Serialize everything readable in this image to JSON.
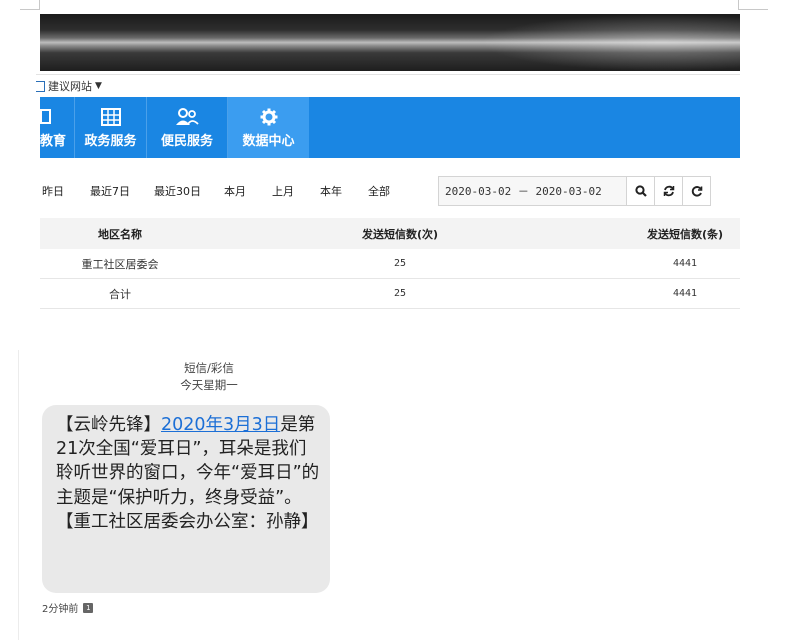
{
  "link_bar": {
    "label": "建议网站"
  },
  "nav": {
    "items": [
      {
        "label": "教育"
      },
      {
        "label": "政务服务"
      },
      {
        "label": "便民服务"
      },
      {
        "label": "数据中心"
      }
    ],
    "active_color": "#3b9df0",
    "bar_color": "#1a86e3"
  },
  "filters": {
    "tabs": [
      "昨日",
      "最近7日",
      "最近30日",
      "本月",
      "上月",
      "本年",
      "全部"
    ],
    "date_range": "2020-03-02 － 2020-03-02"
  },
  "table": {
    "headers": [
      "地区名称",
      "发送短信数(次)",
      "发送短信数(条)"
    ],
    "rows": [
      [
        "重工社区居委会",
        "25",
        "4441"
      ],
      [
        "合计",
        "25",
        "4441"
      ]
    ]
  },
  "message": {
    "channel": "短信/彩信",
    "day": "今天星期一",
    "body_start": "【云岭先锋】",
    "body_link": "2020年3月3日",
    "body_rest": "是第21次全国“爱耳日”，耳朵是我们聆听世界的窗口，今年“爱耳日”的主题是“保护听力，终身受益”。【重工社区居委会办公室：孙静】",
    "time": "2分钟前",
    "sim_label": "1"
  }
}
